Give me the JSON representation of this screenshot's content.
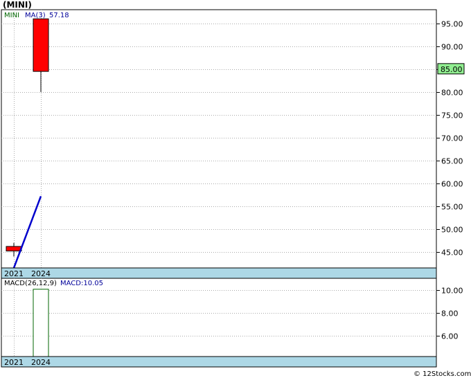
{
  "title": "(MINI)",
  "footer": "© 12Stocks.com",
  "colors": {
    "up_candle": "#ff0000",
    "ma_line": "#0000cc",
    "macd_bar": "#006600",
    "date_band": "#add8e6",
    "grid": "#aaaaaa",
    "price_box": "#90ee90",
    "legend_ticker": "#006600",
    "legend_ma": "#000099"
  },
  "price_panel": {
    "legend": {
      "ticker": "MINI",
      "ma_label": "MA(3)",
      "ma_value": "57.18"
    },
    "current_price_label": "85.00",
    "y_ticks": [
      "95.00",
      "90.00",
      "85.00",
      "80.00",
      "75.00",
      "70.00",
      "65.00",
      "60.00",
      "55.00",
      "50.00",
      "45.00"
    ],
    "x_labels": [
      "2021",
      "2024"
    ]
  },
  "macd_panel": {
    "legend": {
      "label": "MACD(26,12,9)",
      "value_label": "MACD:10.05"
    },
    "y_ticks": [
      "10.00",
      "8.00",
      "6.00"
    ],
    "x_labels": [
      "2021",
      "2024"
    ]
  },
  "chart_data": [
    {
      "type": "candlestick",
      "title": "(MINI)",
      "x": [
        "2021",
        "2024"
      ],
      "candles": [
        {
          "x": "2021",
          "open": 46.2,
          "close": 45.2,
          "high": 47.0,
          "low": 44.0
        },
        {
          "x": "2024",
          "open": 96.0,
          "close": 84.5,
          "high": 96.0,
          "low": 80.0
        }
      ],
      "series": [
        {
          "name": "MA(3)",
          "type": "line",
          "points": [
            [
              "2021",
              41.5
            ],
            [
              "2024",
              57.18
            ]
          ]
        }
      ],
      "ylim": [
        41.5,
        98
      ],
      "y_ticks": [
        45,
        50,
        55,
        60,
        65,
        70,
        75,
        80,
        85,
        90,
        95
      ],
      "current_price": 85.0,
      "grid": true
    },
    {
      "type": "bar",
      "title": "MACD(26,12,9)",
      "categories": [
        "2021",
        "2024"
      ],
      "values": [
        null,
        10.05
      ],
      "ylim": [
        4.2,
        11.0
      ],
      "y_ticks": [
        6,
        8,
        10
      ],
      "grid": true
    }
  ]
}
